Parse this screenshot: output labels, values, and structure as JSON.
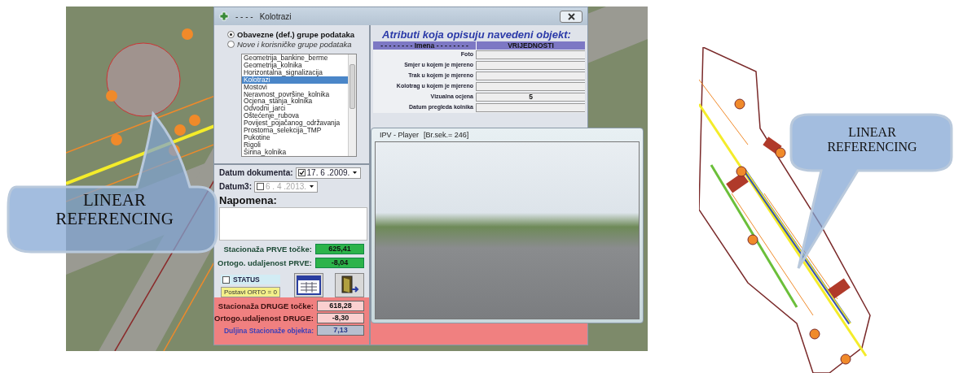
{
  "left_map": {
    "callout": "LINEAR REFERENCING"
  },
  "dialog": {
    "title_dashes": "- - - -",
    "title": "Kolotrazi",
    "data_groups": [
      {
        "label": "Obavezne (def.) grupe podataka",
        "selected": true
      },
      {
        "label": "Nove i korisničke grupe podataka",
        "selected": false
      }
    ],
    "groups_list": [
      {
        "label": "Geometrija_bankine_berme",
        "selected": false
      },
      {
        "label": "Geometrija_kolnika",
        "selected": false
      },
      {
        "label": "Horizontalna_signalizacija",
        "selected": false
      },
      {
        "label": "Kolotrazi",
        "selected": true
      },
      {
        "label": "Mostovi",
        "selected": false
      },
      {
        "label": "Neravnost_površine_kolnika",
        "selected": false
      },
      {
        "label": "Ocjena_stanja_kolnika",
        "selected": false
      },
      {
        "label": "Odvodni_jarci",
        "selected": false
      },
      {
        "label": "Oštećenje_rubova",
        "selected": false
      },
      {
        "label": "Povijest_pojačanog_održavanja",
        "selected": false
      },
      {
        "label": "Prostorna_selekcija_TMP",
        "selected": false
      },
      {
        "label": "Pukotine",
        "selected": false
      },
      {
        "label": "Rigoli",
        "selected": false
      },
      {
        "label": "Širina_kolnika",
        "selected": false
      }
    ],
    "attributes": {
      "title": "Atributi koja opisuju navedeni objekt:",
      "columns": [
        "- - - - - - - -  Imena  - - - - - - - -",
        "VRIJEDNOSTI"
      ],
      "rows": [
        {
          "name": "Foto"
        },
        {
          "name": "Smjer u kojem je mjereno"
        },
        {
          "name": "Trak u kojem je mjereno"
        },
        {
          "name": "Kolotrag u kojem je mjereno"
        },
        {
          "name": "Vizualna ocjena",
          "value": "5"
        },
        {
          "name": "Datum pregleda kolnika"
        }
      ]
    },
    "dates": [
      {
        "label": "Datum dokumenta:",
        "checked": true,
        "value": "17. 6 .2009."
      },
      {
        "label": "Datum3:",
        "checked": false,
        "value": "6 . 4 .2013."
      }
    ],
    "note": {
      "label": "Napomena:"
    },
    "first_point": [
      {
        "label": "Stacionaža PRVE točke:",
        "value": "625,41"
      },
      {
        "label": "Ortogo. udaljenost PRVE:",
        "value": "-8,04"
      }
    ],
    "status": {
      "label": "STATUS",
      "checked": false
    },
    "orto_button": "Postavi ORTO = 0",
    "second_point": [
      {
        "label": "Stacionaža DRUGE točke:",
        "value": "618,28",
        "kind": "point"
      },
      {
        "label": "Ortogo.udaljenost DRUGE:",
        "value": "-8,30",
        "kind": "point"
      },
      {
        "label": "Duljina Stacionaže objekta:",
        "value": "7,13",
        "kind": "length"
      }
    ]
  },
  "player": {
    "title": "IPV - Player",
    "frame_info": "[Br.sek.= 246]"
  },
  "right_map": {
    "callout": "LINEAR REFERENCING"
  }
}
